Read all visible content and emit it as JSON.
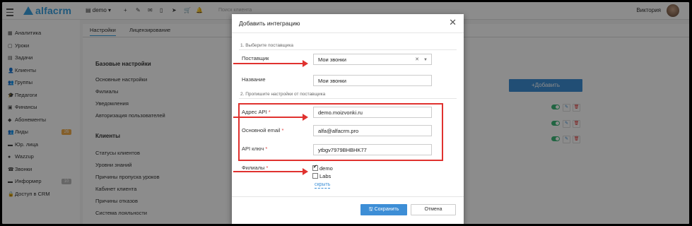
{
  "topbar": {
    "logo_text": "alfacrm",
    "branch": "demo ▾",
    "toolbar_icons": [
      "plus-icon",
      "wrench-icon",
      "mail-icon",
      "phone-icon",
      "telegram-icon",
      "cart-icon",
      "bell-icon"
    ],
    "toolbar_glyphs": [
      "+",
      "✎",
      "✉",
      "▯",
      "➤",
      "🛒",
      "🔔"
    ],
    "search_placeholder": "Поиск клиента",
    "username": "Виктория"
  },
  "sidebar": {
    "items": [
      {
        "label": "Аналитика",
        "glyph": "▦"
      },
      {
        "label": "Уроки",
        "glyph": "▢"
      },
      {
        "label": "Задачи",
        "glyph": "▤"
      },
      {
        "label": "Клиенты",
        "glyph": "👤"
      },
      {
        "label": "Группы",
        "glyph": "👥"
      },
      {
        "label": "Педагоги",
        "glyph": "🎓"
      },
      {
        "label": "Финансы",
        "glyph": "▣"
      },
      {
        "label": "Абонементы",
        "glyph": "◆"
      },
      {
        "label": "Лиды",
        "glyph": "👥",
        "badge": "26",
        "badge_color": "#f0ad4e"
      },
      {
        "label": "Юр. лица",
        "glyph": "▬"
      },
      {
        "label": "Wazzup",
        "glyph": "●"
      },
      {
        "label": "Звонки",
        "glyph": "☎"
      },
      {
        "label": "Информер",
        "glyph": "▬",
        "badge": "10",
        "badge_color": "#bbbbbb"
      },
      {
        "label": "Доступ в CRM",
        "glyph": "🔒"
      }
    ]
  },
  "main": {
    "tabs": [
      "Настройки",
      "Лицензирование"
    ],
    "basic_title": "Базовые настройки",
    "basic_links": [
      "Основные настройки",
      "Филиалы",
      "Уведомления",
      "Авторизация пользователей"
    ],
    "clients_title": "Клиенты",
    "clients_links": [
      "Статусы клиентов",
      "Уровни знаний",
      "Причины пропуска уроков",
      "Кабинет клиента",
      "Причины отказов",
      "Система лояльности"
    ],
    "add_button": "+Добавить"
  },
  "modal": {
    "title": "Добавить интеграцию",
    "step1": "1. Выберите поставщика",
    "provider_label": "Поставщик",
    "provider_value": "Мои звонки",
    "name_label": "Название",
    "name_value": "Мои звонки",
    "step2": "2. Пропишите настройки от поставщика",
    "api_address_label": "Адрес API",
    "api_address_value": "demo.moizvonki.ru",
    "email_label": "Основной email",
    "email_value": "alfa@alfacrm.pro",
    "api_key_label": "API ключ",
    "api_key_value": "ytbgv7979BHBHK77",
    "branches_label": "Филиалы",
    "branches": [
      {
        "label": "demo",
        "checked": true
      },
      {
        "label": "Labs",
        "checked": false
      }
    ],
    "hide_link": "скрыть",
    "save_button": "Сохранить",
    "cancel_button": "Отмена",
    "required_mark": "*"
  },
  "colors": {
    "accent": "#3d8ed6",
    "highlight_red": "#e0322f",
    "toggle_green": "#3cb878"
  }
}
